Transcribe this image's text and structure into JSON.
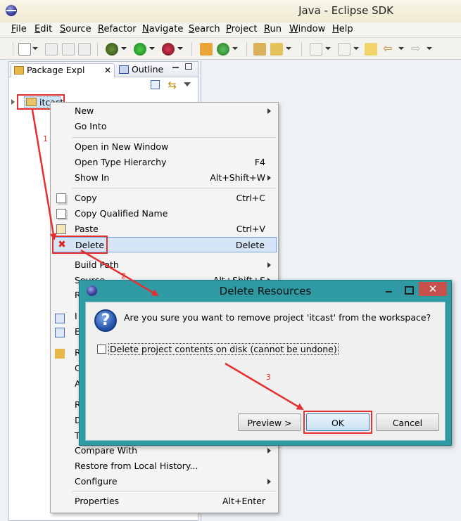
{
  "window": {
    "title": "Java - Eclipse SDK"
  },
  "menubar": [
    "File",
    "Edit",
    "Source",
    "Refactor",
    "Navigate",
    "Search",
    "Project",
    "Run",
    "Window",
    "Help"
  ],
  "views": {
    "package_explorer_tab": "Package Expl",
    "outline_tab": "Outline"
  },
  "tree": {
    "project": "itcast"
  },
  "context_menu": {
    "items": [
      {
        "label": "New",
        "accel": "",
        "submenu": true
      },
      {
        "label": "Go Into",
        "accel": "",
        "submenu": false
      },
      {
        "label": "Open in New Window",
        "accel": "",
        "submenu": false
      },
      {
        "label": "Open Type Hierarchy",
        "accel": "F4",
        "submenu": false
      },
      {
        "label": "Show In",
        "accel": "Alt+Shift+W",
        "submenu": true
      },
      {
        "label": "Copy",
        "accel": "Ctrl+C",
        "submenu": false
      },
      {
        "label": "Copy Qualified Name",
        "accel": "",
        "submenu": false
      },
      {
        "label": "Paste",
        "accel": "Ctrl+V",
        "submenu": false
      },
      {
        "label": "Delete",
        "accel": "Delete",
        "submenu": false
      },
      {
        "label": "Build Path",
        "accel": "",
        "submenu": true
      },
      {
        "label": "Source",
        "accel": "Alt+Shift+S",
        "submenu": true
      },
      {
        "label": "Compare With",
        "accel": "",
        "submenu": true
      },
      {
        "label": "Restore from Local History...",
        "accel": "",
        "submenu": false
      },
      {
        "label": "Configure",
        "accel": "",
        "submenu": true
      },
      {
        "label": "Properties",
        "accel": "Alt+Enter",
        "submenu": false
      }
    ]
  },
  "dialog": {
    "title": "Delete Resources",
    "message": "Are you sure you want to remove project 'itcast' from the workspace?",
    "checkbox_label": "Delete project contents on disk (cannot be undone)",
    "checkbox_checked": false,
    "buttons": {
      "preview": "Preview >",
      "ok": "OK",
      "cancel": "Cancel"
    }
  },
  "annotations": {
    "step1": "1",
    "step2": "2",
    "step3": "3"
  },
  "colors": {
    "annotation": "#e53030",
    "dialog_frame": "#2f9aa4",
    "highlight": "#d5e4f7"
  }
}
